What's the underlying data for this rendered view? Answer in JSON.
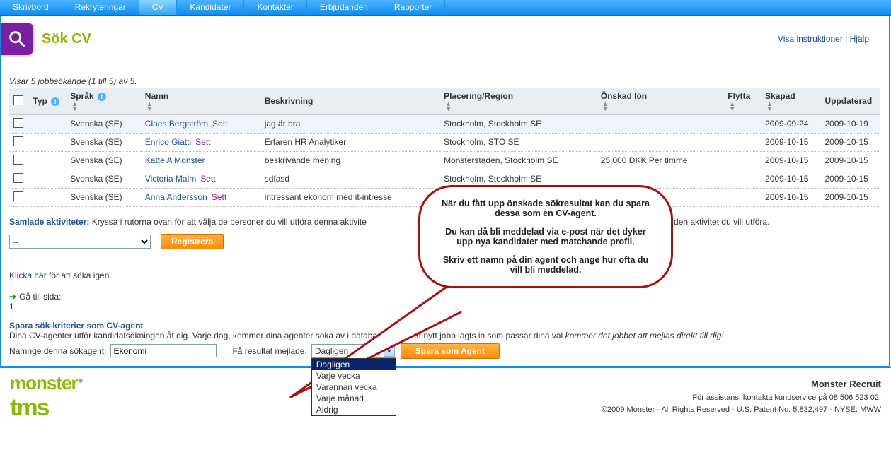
{
  "nav": {
    "items": [
      "Skrivbord",
      "Rekryteringar",
      "CV",
      "Kandidater",
      "Kontakter",
      "Erbjudanden",
      "Rapporter"
    ],
    "active_index": 2
  },
  "page_title": "Sök CV",
  "top_links": {
    "instructions": "Visa instruktioner",
    "separator": " | ",
    "help": "Hjälp"
  },
  "result_count_line": "Visar 5 jobbsökande (1 till 5) av 5.",
  "columns": {
    "typ": "Typ",
    "sprak": "Språk",
    "namn": "Namn",
    "beskrivning": "Beskrivning",
    "placering": "Placering/Region",
    "lon": "Önskad lön",
    "flytta": "Flytta",
    "skapad": "Skapad",
    "uppdaterad": "Uppdaterad"
  },
  "seen_label": "Sett",
  "rows": [
    {
      "sprak": "Svenska (SE)",
      "namn": "Claes Bergström",
      "seen": true,
      "beskrivning": "jag är bra",
      "placering": "Stockholm, Stockholm SE",
      "lon": "",
      "skapad": "2009-09-24",
      "uppdaterad": "2009-10-19"
    },
    {
      "sprak": "Svenska (SE)",
      "namn": "Enrico Giatti",
      "seen": true,
      "beskrivning": "Erfaren HR Analytiker",
      "placering": "Stockholm, STO SE",
      "lon": "",
      "skapad": "2009-10-15",
      "uppdaterad": "2009-10-15"
    },
    {
      "sprak": "Svenska (SE)",
      "namn": "Katte A Monster",
      "seen": false,
      "beskrivning": "beskrivande mening",
      "placering": "Monsterstaden, Stockholm SE",
      "lon": "25,000 DKK Per timme",
      "skapad": "2009-10-15",
      "uppdaterad": "2009-10-15"
    },
    {
      "sprak": "Svenska (SE)",
      "namn": "Victoria Malm",
      "seen": true,
      "beskrivning": "sdfasd",
      "placering": "Stockholm, Stockholm SE",
      "lon": "",
      "skapad": "2009-10-15",
      "uppdaterad": "2009-10-15"
    },
    {
      "sprak": "Svenska (SE)",
      "namn": "Anna Andersson",
      "seen": true,
      "beskrivning": "intressant ekonom med it-intresse",
      "placering": "",
      "lon": "",
      "skapad": "2009-10-15",
      "uppdaterad": "2009-10-15"
    }
  ],
  "bulk": {
    "label": "Samlade aktiviteter:",
    "text_before": " Kryssa i rutorna ovan för att välja de personer du vill utföra denna aktivite",
    "text_after": " personer i listan. Välj sedan den aktivitet du vill utföra.",
    "select_value": "--",
    "button": "Registrera"
  },
  "search_again": {
    "link": "Klicka här",
    "rest": " för att söka igen."
  },
  "goto": {
    "label": "Gå till sida:",
    "value": "1"
  },
  "agent": {
    "header": "Spara sök-kriterier som CV-agent",
    "desc_plain": "Dina CV-agenter utför kandidatsökningen åt dig. Varje dag, kommer dina agenter söka av i databasen. När ett nytt jobb lagts in som passar dina val ",
    "desc_italic": "kommer det jobbet att mejlas direkt till dig!",
    "name_label": "Namnge denna sökagent:",
    "name_value": "Ekonomi",
    "freq_label": "Få resultat mejlade:",
    "freq_value": "Dagligen",
    "freq_options": [
      "Dagligen",
      "Varje vecka",
      "Varannan vecka",
      "Varje månad",
      "Aldrig"
    ],
    "save_button": "Spara som Agent"
  },
  "callout": {
    "p1": "När du fått upp önskade sökresultat kan du spara dessa som en CV-agent.",
    "p2": "Du kan då bli meddelad via e-post när det dyker upp nya kandidater med matchande profil.",
    "p3": "Skriv ett namn på din agent och ange hur ofta du vill bli meddelad."
  },
  "footer": {
    "brand_title": "Monster Recruit",
    "assist": "För assistans, kontakta kundservice på 08 506 523 02.",
    "copyright": "©2009 Monster - All Rights Reserved - U.S. Patent No. 5,832,497 - NYSE: MWW"
  }
}
